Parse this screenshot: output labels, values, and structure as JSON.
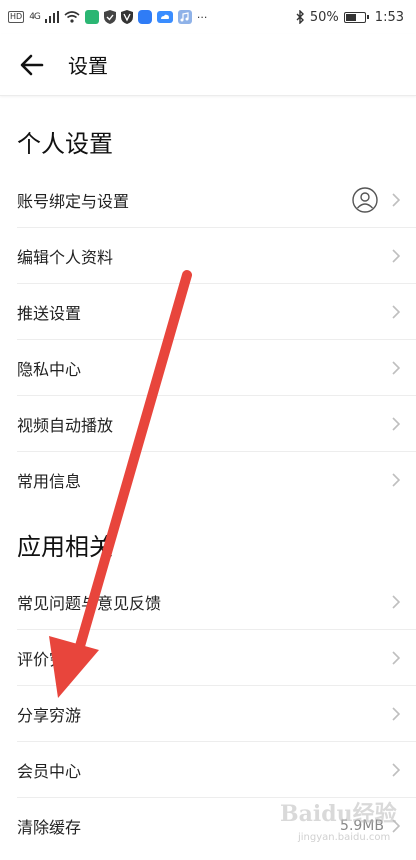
{
  "status_bar": {
    "hd": "HD",
    "signal": "4G",
    "more": "···",
    "battery": "50%",
    "battery_level": 0.5,
    "time": "1:53"
  },
  "header": {
    "title": "设置"
  },
  "sections": {
    "personal": {
      "title": "个人设置",
      "items": [
        {
          "label": "账号绑定与设置"
        },
        {
          "label": "编辑个人资料"
        },
        {
          "label": "推送设置"
        },
        {
          "label": "隐私中心"
        },
        {
          "label": "视频自动播放"
        },
        {
          "label": "常用信息"
        }
      ]
    },
    "app": {
      "title": "应用相关",
      "items": [
        {
          "label": "常见问题与意见反馈"
        },
        {
          "label": "评价穷游"
        },
        {
          "label": "分享穷游"
        },
        {
          "label": "会员中心"
        },
        {
          "label": "清除缓存",
          "value": "5.9MB"
        }
      ]
    }
  },
  "watermark": {
    "brand": "Baidu经验",
    "url": "jingyan.baidu.com"
  },
  "colors": {
    "arrow": "#e8453c",
    "divider": "#ededed",
    "chevron": "#bfbfbf"
  }
}
